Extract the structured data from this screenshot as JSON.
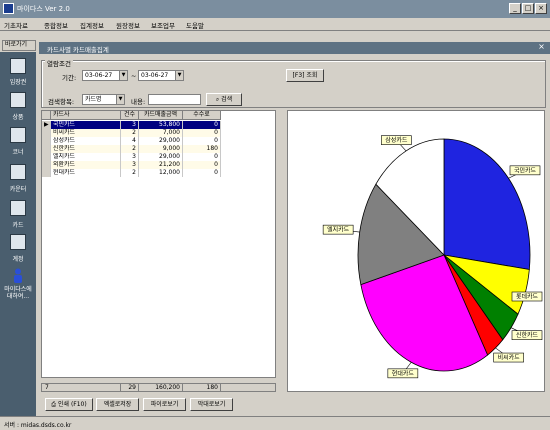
{
  "window": {
    "title": "마이다스 Ver 2.0"
  },
  "menu": [
    "기초자료",
    "종합정보",
    "집계정보",
    "원장정보",
    "보조업무",
    "도움말"
  ],
  "sidebar": {
    "tab_label": "바로가기",
    "items": [
      {
        "label": "입장권",
        "icon": "ticket-icon"
      },
      {
        "label": "상품",
        "icon": "goods-icon"
      },
      {
        "label": "코너",
        "icon": "corner-icon"
      },
      {
        "label": "카운터",
        "icon": "counter-icon"
      },
      {
        "label": "카드",
        "icon": "card-icon"
      },
      {
        "label": "계정",
        "icon": "account-icon"
      },
      {
        "label": "마이다스에 대하여...",
        "icon": "person-icon"
      }
    ]
  },
  "form": {
    "title": "카드사별 카드매출집계",
    "group_label": "열람조건",
    "period_label": "기간:",
    "date_from": "03-06-27",
    "date_sep": "~",
    "date_to": "03-06-27",
    "query_button": "[F3] 조회",
    "search_field_label": "검색항목:",
    "search_field_value": "카드명",
    "content_label": "내용:",
    "content_value": "",
    "search_button": "검색"
  },
  "grid": {
    "columns": [
      "카드사",
      "건수",
      "카드매출금액",
      "수수료"
    ],
    "rows": [
      {
        "name": "국민카드",
        "count": "3",
        "amount": "53,800",
        "fee": "0",
        "selected": true
      },
      {
        "name": "비씨카드",
        "count": "2",
        "amount": "7,000",
        "fee": "0"
      },
      {
        "name": "삼성카드",
        "count": "4",
        "amount": "29,000",
        "fee": "0"
      },
      {
        "name": "신한카드",
        "count": "2",
        "amount": "9,000",
        "fee": "180"
      },
      {
        "name": "엘지카드",
        "count": "3",
        "amount": "29,000",
        "fee": "0"
      },
      {
        "name": "외환카드",
        "count": "3",
        "amount": "21,200",
        "fee": "0"
      },
      {
        "name": "현대카드",
        "count": "2",
        "amount": "12,000",
        "fee": "0"
      }
    ],
    "footer": {
      "rows": "7",
      "count": "29",
      "amount": "160,200",
      "fee": "180"
    }
  },
  "buttons": {
    "print": "인쇄 (F10)",
    "excel": "엑셀로저장",
    "pie": "파이로보기",
    "bar": "막대로보기"
  },
  "status": {
    "text": "서버 : midas.dsds.co.kr"
  },
  "chart_data": {
    "type": "pie",
    "slices": [
      {
        "label": "국민카드",
        "value": 53800,
        "color": "#1f24e0"
      },
      {
        "label": "롯데카드",
        "value": 13000,
        "color": "#ffff00"
      },
      {
        "label": "신한카드",
        "value": 9000,
        "color": "#008000"
      },
      {
        "label": "비씨카드",
        "value": 7000,
        "color": "#ff0000"
      },
      {
        "label": "현대카드",
        "value": 58500,
        "color": "#ff00ff"
      },
      {
        "label": "엘지카드",
        "value": 29000,
        "color": "#808080"
      },
      {
        "label": "삼성카드",
        "value": 29000,
        "color": "#ffffff"
      }
    ]
  }
}
